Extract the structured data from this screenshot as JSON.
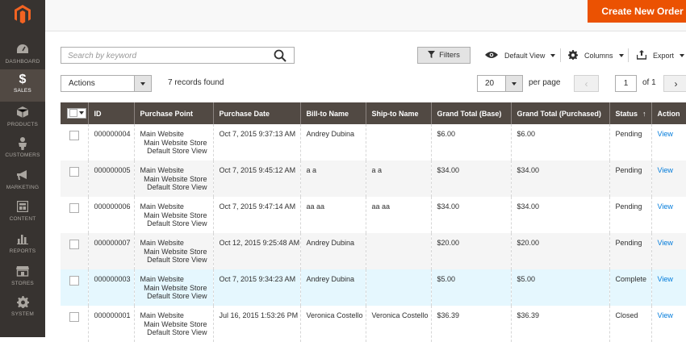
{
  "sidebar": {
    "items": [
      {
        "label": "DASHBOARD",
        "icon": "dashboard-icon"
      },
      {
        "label": "SALES",
        "icon": "dollar-icon",
        "active": true
      },
      {
        "label": "PRODUCTS",
        "icon": "cube-icon"
      },
      {
        "label": "CUSTOMERS",
        "icon": "person-icon"
      },
      {
        "label": "MARKETING",
        "icon": "megaphone-icon"
      },
      {
        "label": "CONTENT",
        "icon": "layout-icon"
      },
      {
        "label": "REPORTS",
        "icon": "bar-chart-icon"
      },
      {
        "label": "STORES",
        "icon": "storefront-icon"
      },
      {
        "label": "SYSTEM",
        "icon": "gear-icon"
      }
    ]
  },
  "header": {
    "create_label": "Create New Order"
  },
  "toolbar": {
    "search_placeholder": "Search by keyword",
    "filters_label": "Filters",
    "view_label": "Default View",
    "columns_label": "Columns",
    "export_label": "Export",
    "actions_label": "Actions",
    "records_found": "7 records found",
    "per_page_value": "20",
    "per_page_label": "per page",
    "page_value": "1",
    "page_of": "of 1"
  },
  "grid": {
    "columns": [
      "ID",
      "Purchase Point",
      "Purchase Date",
      "Bill-to Name",
      "Ship-to Name",
      "Grand Total (Base)",
      "Grand Total (Purchased)",
      "Status",
      "Action"
    ],
    "sort_arrow": "↑",
    "rows": [
      {
        "id": "000000004",
        "pp": [
          "Main Website",
          "Main Website Store",
          "Default Store View"
        ],
        "date": "Oct 7, 2015 9:37:13 AM",
        "bill": "Andrey Dubina",
        "ship": "",
        "base": "$6.00",
        "purchased": "$6.00",
        "status": "Pending",
        "action": "View"
      },
      {
        "id": "000000005",
        "pp": [
          "Main Website",
          "Main Website Store",
          "Default Store View"
        ],
        "date": "Oct 7, 2015 9:45:12 AM",
        "bill": "a a",
        "ship": "a a",
        "base": "$34.00",
        "purchased": "$34.00",
        "status": "Pending",
        "action": "View"
      },
      {
        "id": "000000006",
        "pp": [
          "Main Website",
          "Main Website Store",
          "Default Store View"
        ],
        "date": "Oct 7, 2015 9:47:14 AM",
        "bill": "aa aa",
        "ship": "aa aa",
        "base": "$34.00",
        "purchased": "$34.00",
        "status": "Pending",
        "action": "View"
      },
      {
        "id": "000000007",
        "pp": [
          "Main Website",
          "Main Website Store",
          "Default Store View"
        ],
        "date": "Oct 12, 2015 9:25:48 AM",
        "bill": "Andrey Dubina",
        "ship": "",
        "base": "$20.00",
        "purchased": "$20.00",
        "status": "Pending",
        "action": "View"
      },
      {
        "id": "000000003",
        "pp": [
          "Main Website",
          "Main Website Store",
          "Default Store View"
        ],
        "date": "Oct 7, 2015 9:34:23 AM",
        "bill": "Andrey Dubina",
        "ship": "",
        "base": "$5.00",
        "purchased": "$5.00",
        "status": "Complete",
        "action": "View"
      },
      {
        "id": "000000001",
        "pp": [
          "Main Website",
          "Main Website Store",
          "Default Store View"
        ],
        "date": "Jul 16, 2015 1:53:26 PM",
        "bill": "Veronica Costello",
        "ship": "Veronica Costello",
        "base": "$36.39",
        "purchased": "$36.39",
        "status": "Closed",
        "action": "View"
      }
    ]
  },
  "colors": {
    "brand": "#eb5202",
    "sidebar": "#373330",
    "header_row": "#514943",
    "link": "#007bdb",
    "highlight": "#e5f7fe"
  }
}
